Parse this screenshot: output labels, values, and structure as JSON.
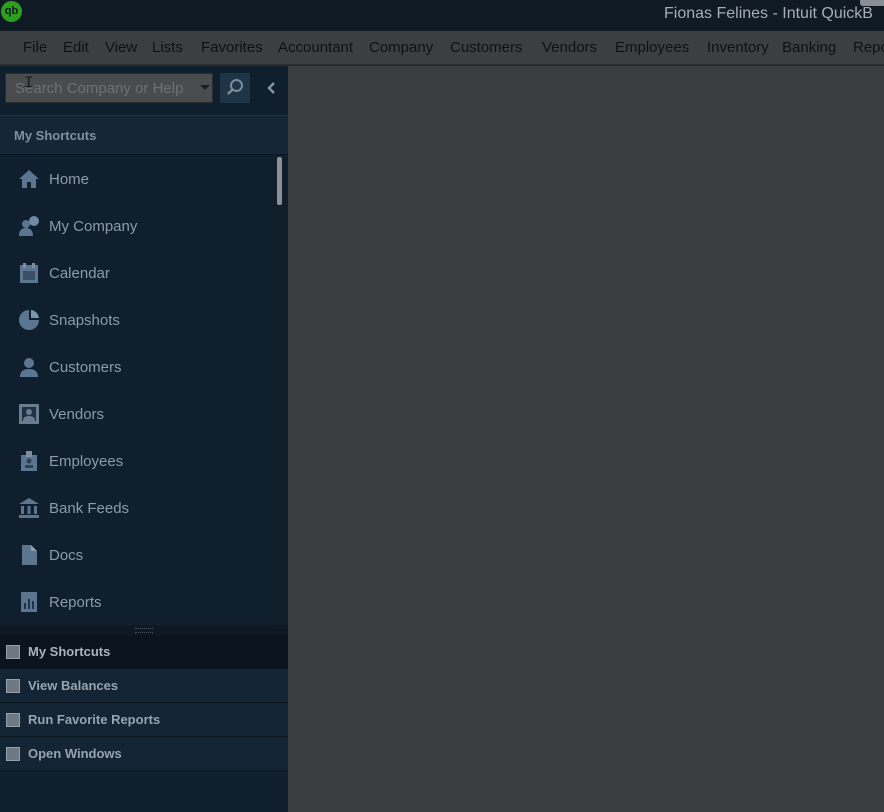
{
  "window": {
    "logo_text": "qb",
    "title": "Fionas Felines  - Intuit QuickB"
  },
  "menubar": {
    "items": [
      "File",
      "Edit",
      "View",
      "Lists",
      "Favorites",
      "Accountant",
      "Company",
      "Customers",
      "Vendors",
      "Employees",
      "Inventory",
      "Banking",
      "Repo"
    ]
  },
  "search": {
    "placeholder": "Search Company or Help"
  },
  "shortcuts": {
    "header": "My Shortcuts",
    "items": [
      {
        "label": "Home",
        "icon": "home-icon"
      },
      {
        "label": "My Company",
        "icon": "my-company-icon"
      },
      {
        "label": "Calendar",
        "icon": "calendar-icon"
      },
      {
        "label": "Snapshots",
        "icon": "snapshots-icon"
      },
      {
        "label": "Customers",
        "icon": "customers-icon"
      },
      {
        "label": "Vendors",
        "icon": "vendors-icon"
      },
      {
        "label": "Employees",
        "icon": "employees-icon"
      },
      {
        "label": "Bank Feeds",
        "icon": "bank-icon"
      },
      {
        "label": "Docs",
        "icon": "docs-icon"
      },
      {
        "label": "Reports",
        "icon": "reports-icon"
      }
    ]
  },
  "bottom_tabs": [
    {
      "label": "My Shortcuts",
      "active": true
    },
    {
      "label": "View Balances",
      "active": false
    },
    {
      "label": "Run Favorite Reports",
      "active": false
    },
    {
      "label": "Open Windows",
      "active": false
    }
  ],
  "colors": {
    "brand_green": "#2ca01c",
    "nav_bg": "#0f1f2e",
    "overlay_gray": "#3b3c3f"
  }
}
